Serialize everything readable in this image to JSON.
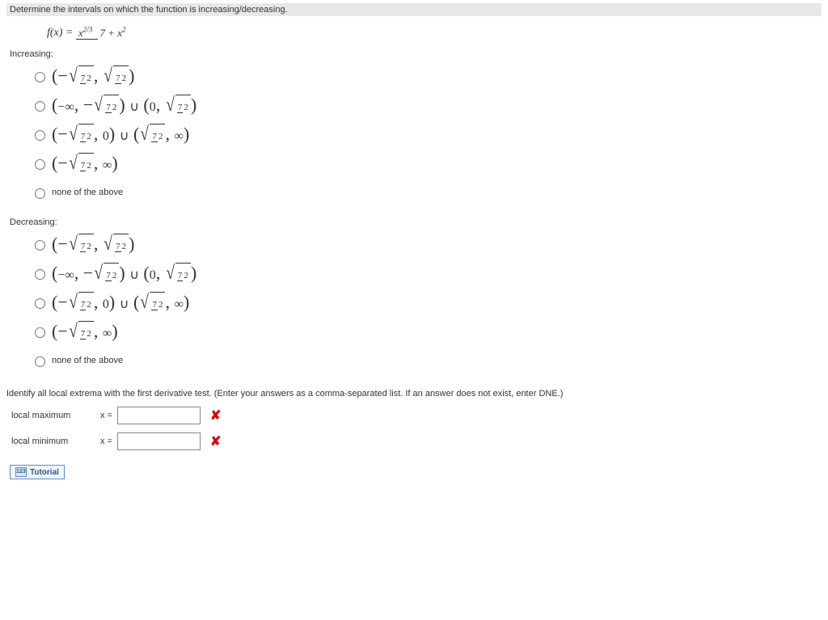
{
  "header": {
    "title": "Determine the intervals on which the function is increasing/decreasing."
  },
  "function": {
    "lhs": "f(x) =",
    "numerator": "x",
    "num_exp": "2/3",
    "denom_left": "7 + x",
    "denom_exp": "2"
  },
  "increasing": {
    "label": "Increasing:",
    "none_label": "none of the above"
  },
  "decreasing": {
    "label": "Decreasing:",
    "none_label": "none of the above"
  },
  "expr": {
    "sqrt_num": "7",
    "sqrt_den": "2",
    "neg_inf": "−∞",
    "inf": "∞",
    "zero": "0",
    "union": "∪"
  },
  "extrema": {
    "prompt": "Identify all local extrema with the first derivative test. (Enter your answers as a comma-separated list. If an answer does not exist, enter DNE.)",
    "max_label": "local maximum",
    "min_label": "local minimum",
    "x_eq": "x =",
    "max_value": "",
    "min_value": ""
  },
  "tutorial": {
    "label": "Tutorial"
  }
}
